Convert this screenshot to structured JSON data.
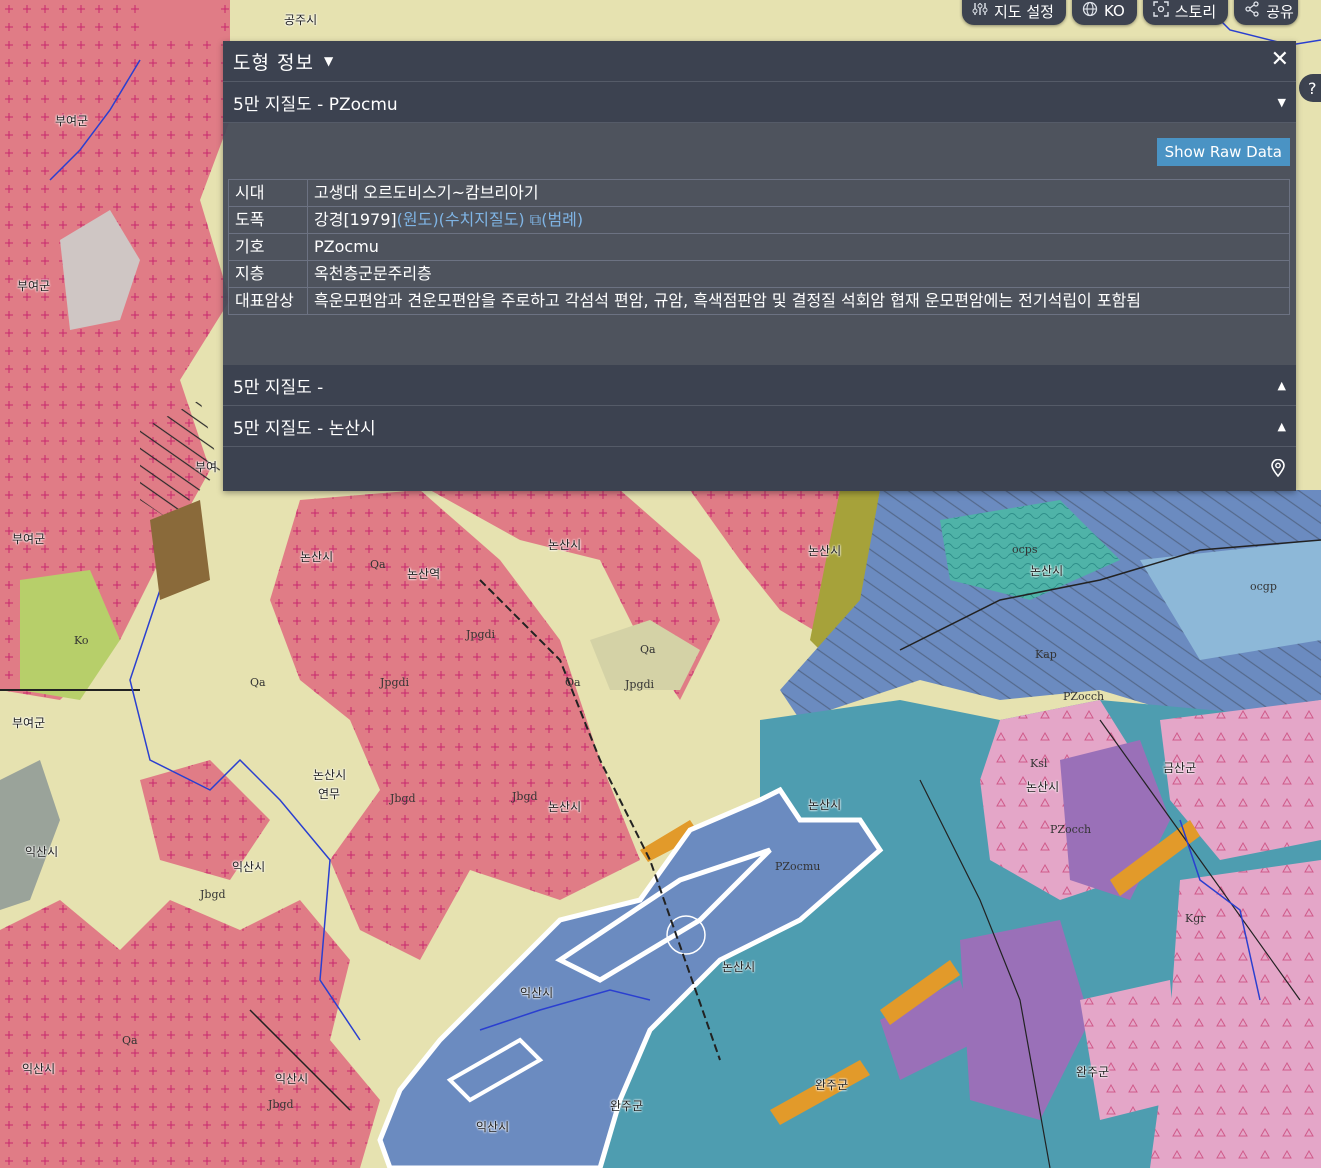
{
  "toolbar": {
    "map_settings": "지도 설정",
    "language": "KO",
    "story": "스토리",
    "share": "공유"
  },
  "help": "?",
  "panel": {
    "title": "도형 정보",
    "close": "✕",
    "sections": [
      {
        "label": "5만 지질도 - PZocmu",
        "state": "expanded"
      },
      {
        "label": "5만 지질도 -",
        "state": "collapsed"
      },
      {
        "label": "5만 지질도 - 논산시",
        "state": "collapsed"
      }
    ],
    "raw_button": "Show Raw Data",
    "rows": {
      "era": {
        "key": "시대",
        "value": "고생대 오르도비스기~캄브리아기"
      },
      "sheet": {
        "key": "도폭",
        "value": "강경[1979]",
        "links": [
          "(원도)",
          "(수치지질도)",
          "⧉(범례)"
        ]
      },
      "symbol": {
        "key": "기호",
        "value": "PZocmu"
      },
      "stratum": {
        "key": "지층",
        "value": "옥천층군문주리층"
      },
      "rock": {
        "key": "대표암상",
        "value": "흑운모편암과 견운모편암을 주로하고 각섬석 편암, 규암, 흑색점판암 및 결정질 석회암 협재 운모편암에는 전기석립이 포함됨"
      }
    }
  },
  "map": {
    "place_labels": [
      "공주시",
      "부여군",
      "부여군",
      "부여군",
      "부여군",
      "논산시",
      "논산시",
      "논산시",
      "논산시",
      "논산시",
      "논산시",
      "논산시",
      "논산시",
      "논산시",
      "익산시",
      "익산시",
      "익산시",
      "익산시",
      "익산시",
      "완주군",
      "완주군",
      "완주군",
      "금산군",
      "논산역",
      "연무",
      "부여",
      "익산시"
    ],
    "unit_codes": [
      "Qa",
      "Qa",
      "Qa",
      "Qa",
      "Qa",
      "Jbgd",
      "Jbgd",
      "Jbgd",
      "Jbgd",
      "Jpgdi",
      "Jpgdi",
      "Jpgdi",
      "PZocmu",
      "PZocch",
      "PZocch",
      "Kgr",
      "Ksl",
      "Kap",
      "ocps",
      "ocgp",
      "Ko"
    ]
  },
  "colors": {
    "granite_pink": "#e07c86",
    "alluvium_yellow": "#e6e2b0",
    "schist_blue": "#6b8bc0",
    "teal": "#4e9db0",
    "purple": "#9a70b8",
    "light_pink": "#e4a6c8",
    "panel_bg": "#3c4250",
    "link_blue": "#7fb4e4",
    "button_blue": "#4a93c4"
  }
}
